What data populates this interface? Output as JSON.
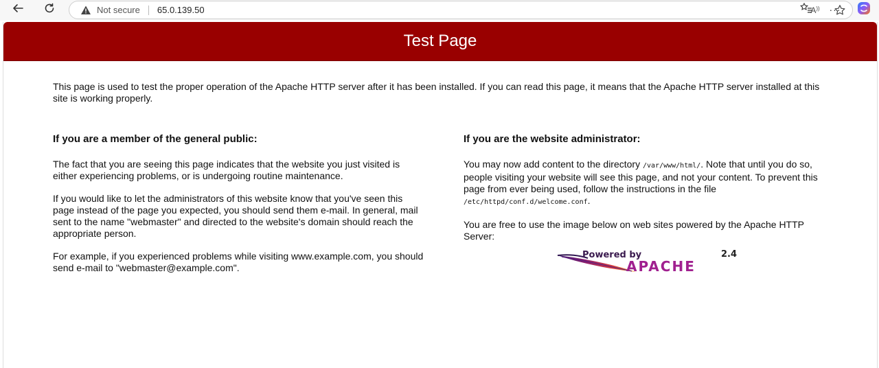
{
  "browser": {
    "security_label": "Not secure",
    "url": "65.0.139.50"
  },
  "page": {
    "title": "Test Page",
    "intro": "This page is used to test the proper operation of the Apache HTTP server after it has been installed. If you can read this page, it means that the Apache HTTP server installed at this site is working properly.",
    "public": {
      "heading": "If you are a member of the general public:",
      "p1": "The fact that you are seeing this page indicates that the website you just visited is either experiencing problems, or is undergoing routine maintenance.",
      "p2": "If you would like to let the administrators of this website know that you've seen this page instead of the page you expected, you should send them e-mail. In general, mail sent to the name \"webmaster\" and directed to the website's domain should reach the appropriate person.",
      "p3": "For example, if you experienced problems while visiting www.example.com, you should send e-mail to \"webmaster@example.com\"."
    },
    "admin": {
      "heading": "If you are the website administrator:",
      "p1_a": "You may now add content to the directory ",
      "p1_dir": "/var/www/html/",
      "p1_b": ". Note that until you do so, people visiting your website will see this page, and not your content. To prevent this page from ever being used, follow the instructions in the file ",
      "p1_file": "/etc/httpd/conf.d/welcome.conf",
      "p1_c": ".",
      "p2": "You are free to use the image below on web sites powered by the Apache HTTP Server:"
    },
    "badge": {
      "powered_by": "Powered by",
      "name": "APACHE",
      "version": "2.4"
    }
  }
}
